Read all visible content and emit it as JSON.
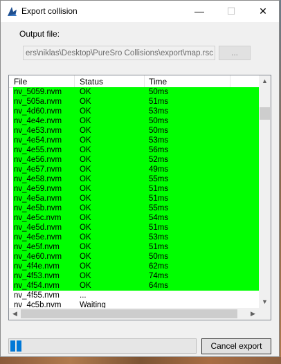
{
  "window": {
    "title": "Export collision",
    "minimize_glyph": "—",
    "maximize_glyph": "☐",
    "close_glyph": "✕"
  },
  "output": {
    "label": "Output file:",
    "path": "ers\\niklas\\Desktop\\PureSro Collisions\\export\\map.rsc",
    "browse_label": "..."
  },
  "list": {
    "columns": [
      "File",
      "Status",
      "Time"
    ],
    "done_rows": [
      {
        "file": "nv_5059.nvm",
        "status": "OK",
        "time": "50ms"
      },
      {
        "file": "nv_505a.nvm",
        "status": "OK",
        "time": "51ms"
      },
      {
        "file": "nv_4d60.nvm",
        "status": "OK",
        "time": "53ms"
      },
      {
        "file": "nv_4e4e.nvm",
        "status": "OK",
        "time": "50ms"
      },
      {
        "file": "nv_4e53.nvm",
        "status": "OK",
        "time": "50ms"
      },
      {
        "file": "nv_4e54.nvm",
        "status": "OK",
        "time": "53ms"
      },
      {
        "file": "nv_4e55.nvm",
        "status": "OK",
        "time": "56ms"
      },
      {
        "file": "nv_4e56.nvm",
        "status": "OK",
        "time": "52ms"
      },
      {
        "file": "nv_4e57.nvm",
        "status": "OK",
        "time": "49ms"
      },
      {
        "file": "nv_4e58.nvm",
        "status": "OK",
        "time": "55ms"
      },
      {
        "file": "nv_4e59.nvm",
        "status": "OK",
        "time": "51ms"
      },
      {
        "file": "nv_4e5a.nvm",
        "status": "OK",
        "time": "51ms"
      },
      {
        "file": "nv_4e5b.nvm",
        "status": "OK",
        "time": "55ms"
      },
      {
        "file": "nv_4e5c.nvm",
        "status": "OK",
        "time": "54ms"
      },
      {
        "file": "nv_4e5d.nvm",
        "status": "OK",
        "time": "51ms"
      },
      {
        "file": "nv_4e5e.nvm",
        "status": "OK",
        "time": "53ms"
      },
      {
        "file": "nv_4e5f.nvm",
        "status": "OK",
        "time": "51ms"
      },
      {
        "file": "nv_4e60.nvm",
        "status": "OK",
        "time": "50ms"
      },
      {
        "file": "nv_4f4e.nvm",
        "status": "OK",
        "time": "62ms"
      },
      {
        "file": "nv_4f53.nvm",
        "status": "OK",
        "time": "74ms"
      },
      {
        "file": "nv_4f54.nvm",
        "status": "OK",
        "time": "64ms"
      }
    ],
    "pending_rows": [
      {
        "file": "nv_4f55.nvm",
        "status": "...",
        "time": ""
      },
      {
        "file": "nv_4c5b.nvm",
        "status": "Waiting",
        "time": ""
      }
    ],
    "ok_row_color": "#00ff00",
    "scroll_up_glyph": "▲",
    "scroll_down_glyph": "▼",
    "scroll_left_glyph": "◀",
    "scroll_right_glyph": "▶"
  },
  "progress": {
    "fraction": 0.06,
    "color": "#0078d7"
  },
  "cancel_label": "Cancel export"
}
